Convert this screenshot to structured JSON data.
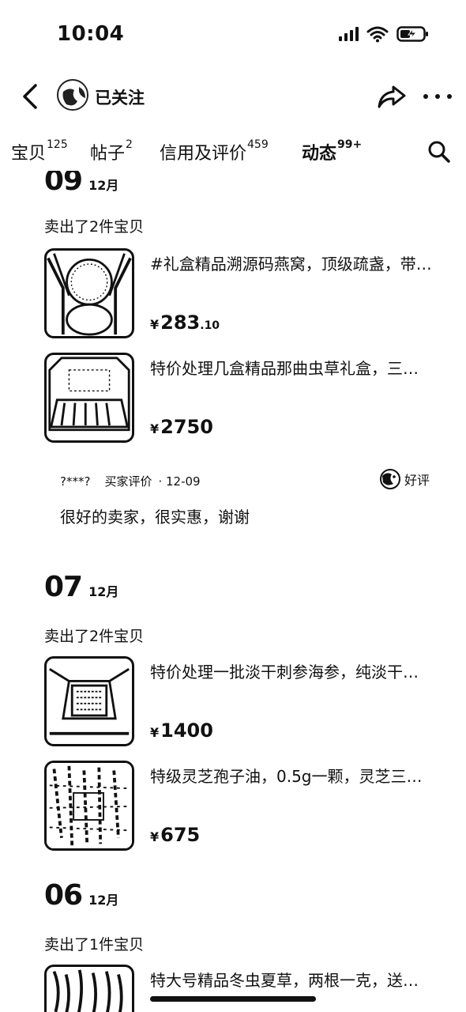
{
  "status_bar": {
    "time": "10:04"
  },
  "nav": {
    "follow_label": "已关注"
  },
  "tabs": [
    {
      "label": "宝贝",
      "count": "125"
    },
    {
      "label": "帖子",
      "count": "2"
    },
    {
      "label": "信用及评价",
      "count": "459"
    },
    {
      "label": "动态",
      "count": "99+"
    }
  ],
  "feed": [
    {
      "day": "09",
      "month": "12月",
      "sold_label": "卖出了2件宝贝",
      "items": [
        {
          "title": "#礼盒精品溯源码燕窝，顶级疏盏，带…",
          "price_int": "283",
          "price_dec": ".10"
        },
        {
          "title": "特价处理几盒精品那曲虫草礼盒，三…",
          "price_int": "2750",
          "price_dec": ""
        }
      ],
      "review": {
        "buyer": "?***?",
        "type": "买家评价",
        "date": "· 12-09",
        "rating": "好评",
        "text": "很好的卖家，很实惠，谢谢"
      }
    },
    {
      "day": "07",
      "month": "12月",
      "sold_label": "卖出了2件宝贝",
      "items": [
        {
          "title": "特价处理一批淡干刺参海参，纯淡干…",
          "price_int": "1400",
          "price_dec": ""
        },
        {
          "title": "特级灵芝孢子油，0.5g一颗，灵芝三…",
          "price_int": "675",
          "price_dec": ""
        }
      ]
    },
    {
      "day": "06",
      "month": "12月",
      "sold_label": "卖出了1件宝贝",
      "items": [
        {
          "title": "特大号精品冬虫夏草，两根一克，送…",
          "price_int": "",
          "price_dec": ""
        }
      ]
    }
  ],
  "currency_symbol": "¥",
  "colors": {
    "text": "#111111",
    "background": "#ffffff"
  }
}
